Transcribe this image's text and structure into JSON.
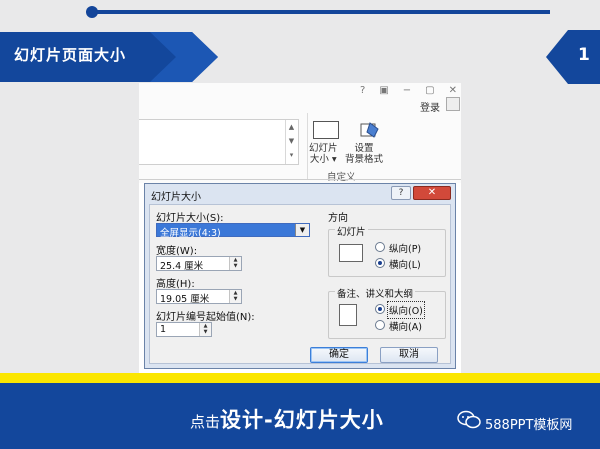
{
  "slide": {
    "title": "幻灯片页面大小",
    "page_number": "1",
    "accent_color": "#13479c",
    "highlight_color": "#fbe600"
  },
  "window": {
    "controls": [
      "?",
      "▣",
      "−",
      "▢",
      "✕"
    ],
    "login": "登录"
  },
  "ribbon": {
    "slide_size_label_1": "幻灯片",
    "slide_size_label_2": "大小 ▾",
    "bg_format_label_1": "设置",
    "bg_format_label_2": "背景格式",
    "group_label": "自定义"
  },
  "dialog": {
    "title": "幻灯片大小",
    "help": "?",
    "close": "✕",
    "size_label": "幻灯片大小(S):",
    "size_value": "全屏显示(4:3)",
    "width_label": "宽度(W):",
    "width_value": "25.4 厘米",
    "height_label": "高度(H):",
    "height_value": "19.05 厘米",
    "start_label": "幻灯片编号起始值(N):",
    "start_value": "1",
    "orientation_label": "方向",
    "slides_group": "幻灯片",
    "slides_portrait": "纵向(P)",
    "slides_landscape": "横向(L)",
    "notes_group": "备注、讲义和大纲",
    "notes_portrait": "纵向(O)",
    "notes_landscape": "横向(A)",
    "ok": "确定",
    "cancel": "取消"
  },
  "footer": {
    "prefix": "点击",
    "main": "设计-幻灯片大小",
    "brand": "588PPT模板网"
  }
}
